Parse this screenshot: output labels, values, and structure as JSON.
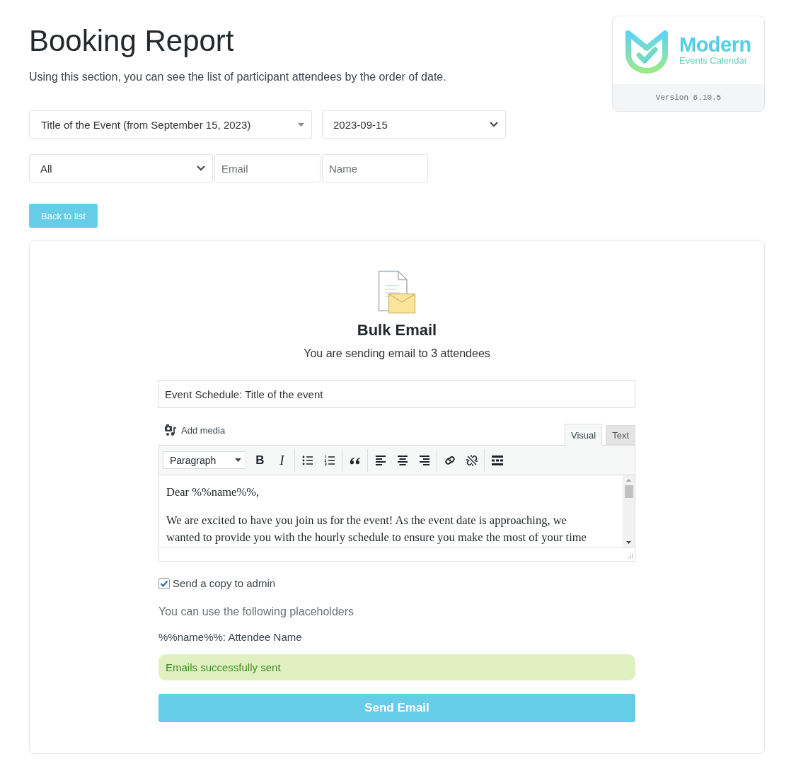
{
  "page": {
    "title": "Booking Report",
    "description": "Using this section, you can see the list of participant attendees by the order of date."
  },
  "logo_card": {
    "brand": "Modern",
    "tagline": "Events Calendar",
    "version": "Version 6.10.5"
  },
  "filters": [
    [
      {
        "kind": "dropdown",
        "value": "Title of the Event (from September 15, 2023)"
      },
      {
        "kind": "select",
        "value": "2023-09-15"
      }
    ],
    [
      {
        "kind": "select",
        "value": "All"
      },
      {
        "kind": "input",
        "placeholder": "Email"
      },
      {
        "kind": "input",
        "placeholder": "Name"
      }
    ]
  ],
  "back_button": "Back to list",
  "bulk_email": {
    "title": "Bulk Email",
    "subtitle": "You are sending email to 3 attendees",
    "subject": {
      "value": "Event Schedule: Title of the event"
    },
    "editor": {
      "add_media": "Add media",
      "tabs": [
        {
          "label": "Visual",
          "selected": true
        },
        {
          "label": "Text",
          "selected": false
        }
      ],
      "format": "Paragraph",
      "toolbar": [
        [
          {
            "kind": "bold",
            "label": "B"
          },
          {
            "kind": "italic",
            "label": "I"
          }
        ],
        [
          {
            "kind": "bullet-list"
          },
          {
            "kind": "numbered-list"
          }
        ],
        [
          {
            "kind": "quote"
          }
        ],
        [
          {
            "kind": "align-left"
          },
          {
            "kind": "align-center"
          },
          {
            "kind": "align-right"
          }
        ],
        [
          {
            "kind": "link"
          },
          {
            "kind": "unlink"
          }
        ],
        [
          {
            "kind": "toolbar-toggle"
          }
        ]
      ],
      "paragraphs": [
        "Dear %%name%%,",
        "We are excited to have you join us for the event! As the event date is approaching, we wanted to provide you with the hourly schedule to ensure you make the most of your time"
      ]
    },
    "copy_to_admin": {
      "label": "Send a copy to admin",
      "checked": true
    },
    "placeholders": {
      "hint": "You can use the following placeholders",
      "items": [
        "%%name%%: Attendee Name"
      ]
    },
    "alert": {
      "message": "Emails successfully sent"
    },
    "send_button": "Send Email"
  }
}
